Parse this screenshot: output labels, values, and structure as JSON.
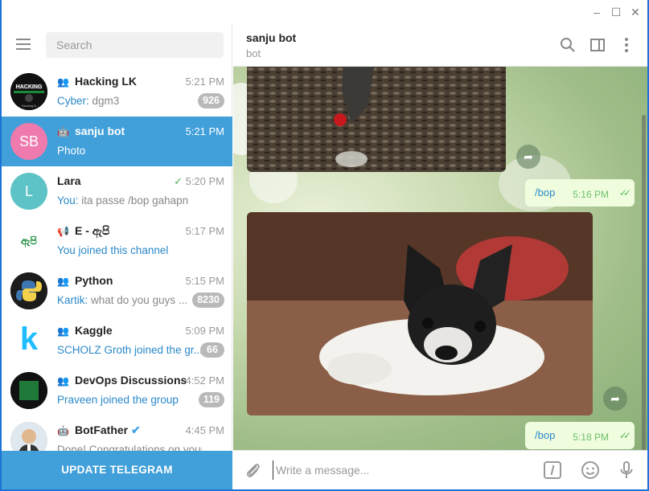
{
  "window": {
    "controls": [
      "–",
      "☐",
      "✕"
    ]
  },
  "sidebar": {
    "search_placeholder": "Search",
    "update_label": "UPDATE TELEGRAM",
    "chats": [
      {
        "name": "Hacking LK",
        "type": "group",
        "time": "5:21 PM",
        "sender": "Cyber:",
        "preview": " dgm3",
        "badge": "926",
        "avatar_color": "#111111"
      },
      {
        "name": "sanju bot",
        "type": "bot",
        "time": "5:21 PM",
        "preview": "Photo",
        "initials": "SB",
        "avatar_color": "#ee7aae",
        "active": true
      },
      {
        "name": "Lara",
        "type": "user",
        "time": "5:20 PM",
        "sender": "You:",
        "preview": " ita passe /bop gahapn",
        "initials": "L",
        "avatar_color": "#5ec3c6",
        "read": true
      },
      {
        "name": "E - ඇපි",
        "type": "channel",
        "time": "5:17 PM",
        "preview": "You joined this channel",
        "avatar_text": "ඇපි",
        "avatar_color": "#ffffff"
      },
      {
        "name": "Python",
        "type": "group",
        "time": "5:15 PM",
        "sender": "Kartik:",
        "preview": " what do you guys ...",
        "badge": "8230",
        "avatar_color": "#1c1c1c"
      },
      {
        "name": "Kaggle",
        "type": "group",
        "time": "5:09 PM",
        "preview": "SCHOLZ Groth joined the gr...",
        "badge": "66",
        "avatar_text": "k",
        "avatar_color": "#ffffff"
      },
      {
        "name": "DevOps Discussions",
        "type": "group",
        "time": "4:52 PM",
        "preview": "Praveen joined the group",
        "badge": "119",
        "avatar_color": "#111111"
      },
      {
        "name": "BotFather",
        "type": "bot",
        "time": "4:45 PM",
        "preview": "Done! Congratulations on your n...",
        "verified": true,
        "avatar_color": "#c8b090"
      }
    ]
  },
  "header": {
    "name": "sanju bot",
    "status": "bot"
  },
  "messages": [
    {
      "type": "photo",
      "subject": "leaves"
    },
    {
      "type": "text",
      "text": "/bop",
      "time": "5:16 PM",
      "ticks": "✓✓"
    },
    {
      "type": "photo",
      "subject": "dog"
    },
    {
      "type": "text",
      "text": "/bop",
      "time": "5:18 PM",
      "ticks": "✓✓"
    }
  ],
  "composer": {
    "placeholder": "Write a message..."
  },
  "colors": {
    "accent": "#419fd9",
    "bubble": "#effdde",
    "link": "#2a88c8"
  }
}
